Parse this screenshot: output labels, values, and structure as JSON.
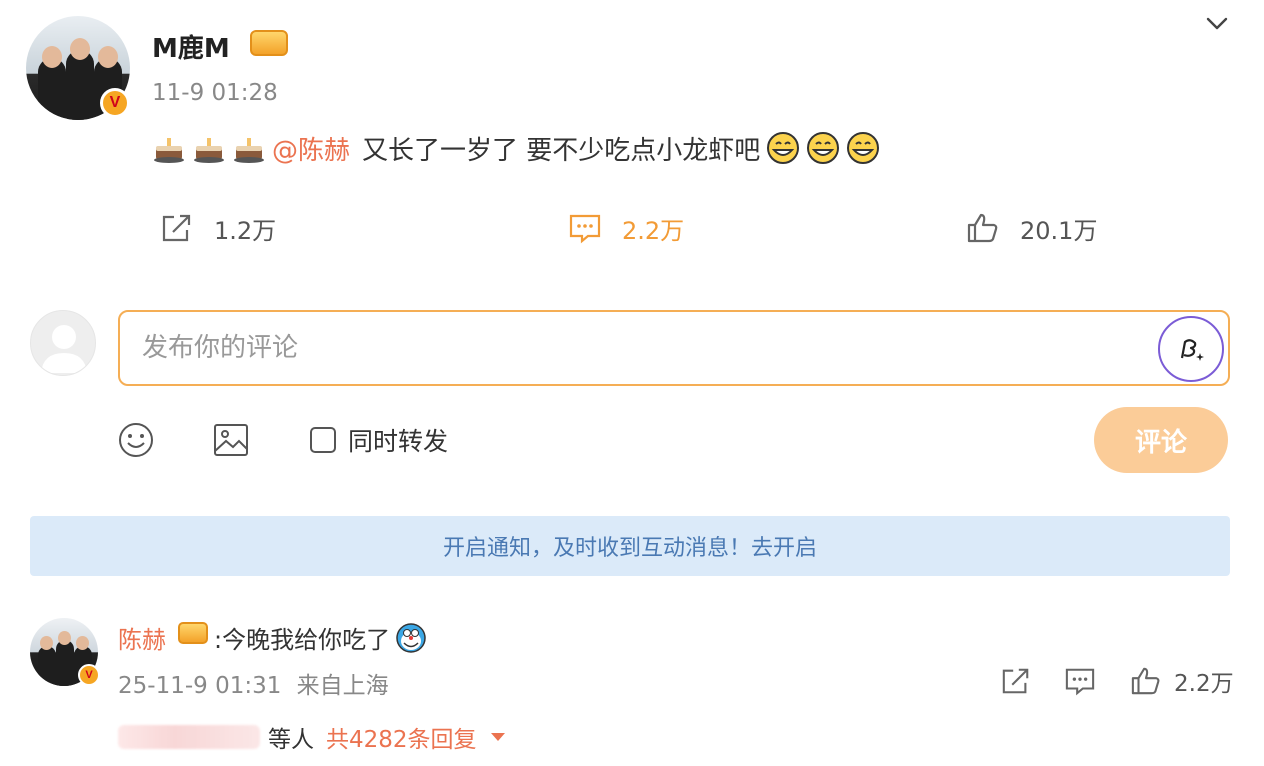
{
  "post": {
    "username": "M鹿M",
    "time": "11-9 01:28",
    "verified_badge": "V",
    "body": {
      "mention": "@陈赫",
      "text": "又长了一岁了 要不少吃点小龙虾吧"
    },
    "leading_icons": [
      "cake-icon",
      "cake-icon",
      "cake-icon"
    ],
    "trailing_icons": [
      "grin-emoji",
      "grin-emoji",
      "grin-emoji"
    ],
    "stats": {
      "shares": "1.2万",
      "comments": "2.2万",
      "likes": "20.1万"
    }
  },
  "composer": {
    "placeholder": "发布你的评论",
    "repost_label": "同时转发",
    "submit_label": "评论"
  },
  "notice": {
    "text": "开启通知，及时收到互动消息！去开启"
  },
  "reply": {
    "username": "陈赫",
    "text": ":今晚我给你吃了",
    "time": "25-11-9 01:31",
    "location": "来自上海",
    "likes": "2.2万",
    "verified_badge": "V",
    "others_label": "等人",
    "reply_count": "共4282条回复"
  },
  "colors": {
    "accent_orange": "#eb7350",
    "stat_orange": "#f29b36",
    "input_border": "#f5ae55",
    "submit_bg": "#fbcc98",
    "notice_bg": "#dbeaf9",
    "notice_text": "#4a79b3"
  }
}
